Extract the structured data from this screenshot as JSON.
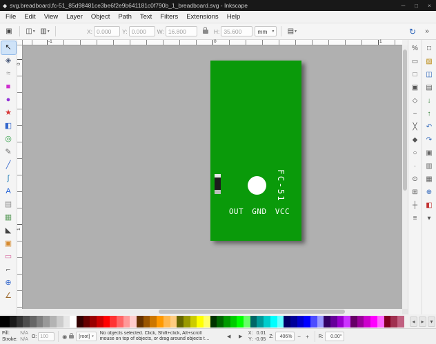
{
  "titlebar": {
    "logo": "◆",
    "title": "svg.breadboard.fc-51_85d98481ce3be6f2e9b641181c0f790b_1_breadboard.svg - Inkscape",
    "minimize": "─",
    "maximize": "□",
    "close": "×"
  },
  "menubar": {
    "items": [
      "File",
      "Edit",
      "View",
      "Layer",
      "Object",
      "Path",
      "Text",
      "Filters",
      "Extensions",
      "Help"
    ]
  },
  "toolbar": {
    "x_label": "X:",
    "x_value": "0.000",
    "y_label": "Y:",
    "y_value": "0.000",
    "w_label": "W:",
    "w_value": "16.800",
    "h_label": "H:",
    "h_value": "35.600",
    "units_value": "mm",
    "icons": {
      "select_all": "▣",
      "selection_dropdown": "◫",
      "transform_dropdown": "▥",
      "scale_dropdown": "▤",
      "caret": "▾",
      "refresh": "↻",
      "overflow": "»"
    }
  },
  "toolbox": {
    "tools": [
      {
        "name": "select-tool",
        "glyph": "↖",
        "color": "#1a1a1a"
      },
      {
        "name": "node-tool",
        "glyph": "◈",
        "color": "#4a5a7a"
      },
      {
        "name": "tweak-tool",
        "glyph": "≈",
        "color": "#888888"
      },
      {
        "name": "rectangle-tool",
        "glyph": "■",
        "color": "#cf2fcf"
      },
      {
        "name": "ellipse-tool",
        "glyph": "●",
        "color": "#9333d6"
      },
      {
        "name": "star-tool",
        "glyph": "★",
        "color": "#d63333"
      },
      {
        "name": "box3d-tool",
        "glyph": "◧",
        "color": "#3366cc"
      },
      {
        "name": "spiral-tool",
        "glyph": "◎",
        "color": "#2f9e44"
      },
      {
        "name": "pencil-tool",
        "glyph": "✎",
        "color": "#666666"
      },
      {
        "name": "pen-tool",
        "glyph": "╱",
        "color": "#3366cc"
      },
      {
        "name": "calligraphy-tool",
        "glyph": "∫",
        "color": "#1a7ab5"
      },
      {
        "name": "text-tool",
        "glyph": "A",
        "color": "#1f5fd6"
      },
      {
        "name": "gradient-tool",
        "glyph": "▤",
        "color": "#8a8a8a"
      },
      {
        "name": "mesh-tool",
        "glyph": "▦",
        "color": "#5f9e5f"
      },
      {
        "name": "dropper-tool",
        "glyph": "◣",
        "color": "#444444"
      },
      {
        "name": "bucket-tool",
        "glyph": "▣",
        "color": "#d68a2f"
      },
      {
        "name": "eraser-tool",
        "glyph": "▭",
        "color": "#d6669e"
      },
      {
        "name": "connector-tool",
        "glyph": "⌐",
        "color": "#666666"
      },
      {
        "name": "zoom-tool",
        "glyph": "⊕",
        "color": "#3366cc"
      },
      {
        "name": "measure-tool",
        "glyph": "∠",
        "color": "#9e6b2f"
      }
    ]
  },
  "rulers": {
    "h": [
      "-1",
      "0",
      "1"
    ],
    "v": [
      "0",
      "1"
    ]
  },
  "pcb": {
    "board_color": "#0a9a0a",
    "vertical_label": "FC-51",
    "pin_label": "OUT GND VCC"
  },
  "snapbar": {
    "items": [
      {
        "name": "snap-toggle",
        "glyph": "%"
      },
      {
        "name": "snap-bbox",
        "glyph": "▭"
      },
      {
        "name": "snap-bbox-edges",
        "glyph": "□"
      },
      {
        "name": "snap-bbox-corners",
        "glyph": "▣"
      },
      {
        "name": "snap-nodes",
        "glyph": "◇"
      },
      {
        "name": "snap-paths",
        "glyph": "~"
      },
      {
        "name": "snap-intersections",
        "glyph": "╳"
      },
      {
        "name": "snap-cusp-nodes",
        "glyph": "◆"
      },
      {
        "name": "snap-smooth-nodes",
        "glyph": "○"
      },
      {
        "name": "snap-midpoints",
        "glyph": "∙"
      },
      {
        "name": "snap-object-centers",
        "glyph": "⊙"
      },
      {
        "name": "snap-page-border",
        "glyph": "⊞"
      },
      {
        "name": "snap-grid",
        "glyph": "┼"
      },
      {
        "name": "snap-guides",
        "glyph": "≡"
      }
    ]
  },
  "commandsbar": {
    "items": [
      {
        "name": "new-document",
        "glyph": "□",
        "color": "#444444"
      },
      {
        "name": "open-document",
        "glyph": "▨",
        "color": "#b8860b"
      },
      {
        "name": "save-document",
        "glyph": "◫",
        "color": "#2a62b8"
      },
      {
        "name": "print-document",
        "glyph": "▤",
        "color": "#555555"
      },
      {
        "name": "import-image",
        "glyph": "↓",
        "color": "#2e7d32"
      },
      {
        "name": "export-image",
        "glyph": "↑",
        "color": "#2e7d32"
      },
      {
        "name": "undo",
        "glyph": "↶",
        "color": "#2a62b8"
      },
      {
        "name": "redo",
        "glyph": "↷",
        "color": "#2a62b8"
      },
      {
        "name": "copy",
        "glyph": "▣",
        "color": "#666666"
      },
      {
        "name": "paste",
        "glyph": "▥",
        "color": "#666666"
      },
      {
        "name": "duplicate",
        "glyph": "▦",
        "color": "#666666"
      },
      {
        "name": "zoom-page",
        "glyph": "⊕",
        "color": "#2a62b8"
      },
      {
        "name": "fill-stroke-dialog",
        "glyph": "◧",
        "color": "#c23333"
      },
      {
        "name": "more-options",
        "glyph": "▾",
        "color": "#555555"
      }
    ]
  },
  "palette": {
    "colors": [
      "#000000",
      "#1a1a1a",
      "#333333",
      "#4d4d4d",
      "#666666",
      "#808080",
      "#999999",
      "#b3b3b3",
      "#cccccc",
      "#e6e6e6",
      "#ffffff",
      "#330000",
      "#660000",
      "#990000",
      "#cc0000",
      "#ff0000",
      "#ff3333",
      "#ff6666",
      "#ff9999",
      "#ffcccc",
      "#663300",
      "#995500",
      "#cc7700",
      "#ff9900",
      "#ffb74d",
      "#ffcc80",
      "#666600",
      "#999900",
      "#cccc00",
      "#ffff00",
      "#ffff66",
      "#003300",
      "#006600",
      "#009900",
      "#00cc00",
      "#00ff00",
      "#66ff66",
      "#006666",
      "#009999",
      "#00cccc",
      "#00ffff",
      "#66ffff",
      "#000066",
      "#000099",
      "#0000cc",
      "#0000ff",
      "#4d4dff",
      "#9999ff",
      "#330066",
      "#660099",
      "#9900cc",
      "#cc33ff",
      "#660066",
      "#990099",
      "#cc00cc",
      "#ff00ff",
      "#ff66ff",
      "#800020",
      "#a03050",
      "#c06080"
    ],
    "controls": {
      "scroll_left": "◂",
      "scroll_right": "▸",
      "menu": "▾"
    }
  },
  "statusbar": {
    "fill_label": "Fill:",
    "fill_value": "N/A",
    "stroke_label": "Stroke:",
    "stroke_value": "N/A",
    "opacity_label": "O:",
    "opacity_value": "100",
    "eye_icon": "◉",
    "layer_name": "[root]",
    "layer_caret": "▾",
    "message_line1": "No objects selected. Click, Shift+click, Alt+scroll",
    "message_line2": "mouse on top of objects, or drag around objects t…",
    "nav_left": "◀",
    "nav_right": "▶",
    "x_label": "X:",
    "x_value": "0.01",
    "y_label": "Y:",
    "y_value": "-0.05",
    "zoom_label": "Z:",
    "zoom_value": "406%",
    "zoom_minus": "−",
    "zoom_plus": "+",
    "rotation_label": "R:",
    "rotation_value": "0.00°"
  }
}
